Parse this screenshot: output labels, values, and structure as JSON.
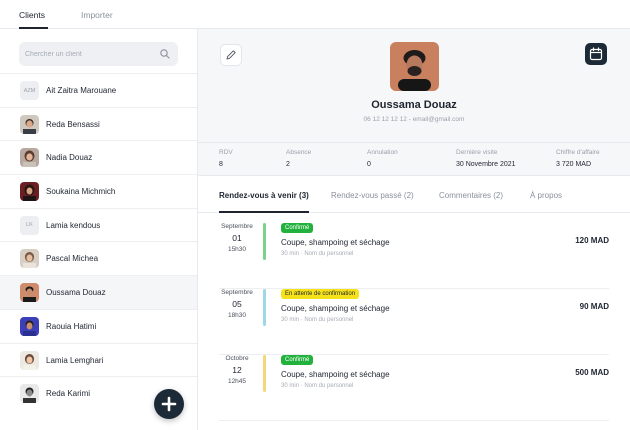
{
  "top_tabs": [
    {
      "label": "Clients",
      "active": true
    },
    {
      "label": "Importer",
      "active": false
    }
  ],
  "search": {
    "placeholder": "Chercher un client",
    "icon": "search-icon"
  },
  "clients": [
    {
      "name": "Ait Zaitra Marouane",
      "initials": "AZM"
    },
    {
      "name": "Reda Bensassi",
      "initials": ""
    },
    {
      "name": "Nadia Douaz",
      "initials": ""
    },
    {
      "name": "Soukaina Michmich",
      "initials": ""
    },
    {
      "name": "Lamia kendous",
      "initials": "LK"
    },
    {
      "name": "Pascal Michea",
      "initials": ""
    },
    {
      "name": "Oussama Douaz",
      "initials": "",
      "selected": true
    },
    {
      "name": "Raouia Hatimi",
      "initials": ""
    },
    {
      "name": "Lamia Lemghari",
      "initials": ""
    },
    {
      "name": "Reda Karimi",
      "initials": ""
    }
  ],
  "fab": {
    "icon": "plus-icon"
  },
  "profile": {
    "name": "Oussama Douaz",
    "contact": "06 12 12 12 12 - email@gmail.com",
    "edit_icon": "pencil-icon",
    "calendar_icon": "calendar-icon"
  },
  "stats": [
    {
      "label": "RDV",
      "value": "8"
    },
    {
      "label": "Absence",
      "value": "2"
    },
    {
      "label": "Annulation",
      "value": "0"
    },
    {
      "label": "Dernière visite",
      "value": "30 Novembre 2021"
    },
    {
      "label": "Chiffre d'affaire",
      "value": "3 720 MAD"
    }
  ],
  "tabs": [
    {
      "label": "Rendez-vous à venir (3)",
      "active": true
    },
    {
      "label": "Rendez-vous passé (2)",
      "active": false
    },
    {
      "label": "Commentaires (2)",
      "active": false
    },
    {
      "label": "À propos",
      "active": false
    }
  ],
  "appointments": [
    {
      "month": "Septembre",
      "day": "01",
      "time": "15h30",
      "status": "Confirmé",
      "service": "Coupe, shampoing et séchage",
      "meta": "30 min · Nom du personnel",
      "price": "120 MAD",
      "bar_color": "#7fd08a",
      "badge_bg": "#22b13c",
      "badge_fg": "#ffffff"
    },
    {
      "month": "Septembre",
      "day": "05",
      "time": "18h30",
      "status": "En attente de confirmation",
      "service": "Coupe, shampoing et séchage",
      "meta": "30 min · Nom du personnel",
      "price": "90 MAD",
      "bar_color": "#9fd7ea",
      "badge_bg": "#f5e21b",
      "badge_fg": "#1e2430"
    },
    {
      "month": "Octobre",
      "day": "12",
      "time": "12h45",
      "status": "Confirmé",
      "service": "Coupe, shampoing et séchage",
      "meta": "30 min · Nom du personnel",
      "price": "500 MAD",
      "bar_color": "#f3d77a",
      "badge_bg": "#22b13c",
      "badge_fg": "#ffffff"
    }
  ]
}
